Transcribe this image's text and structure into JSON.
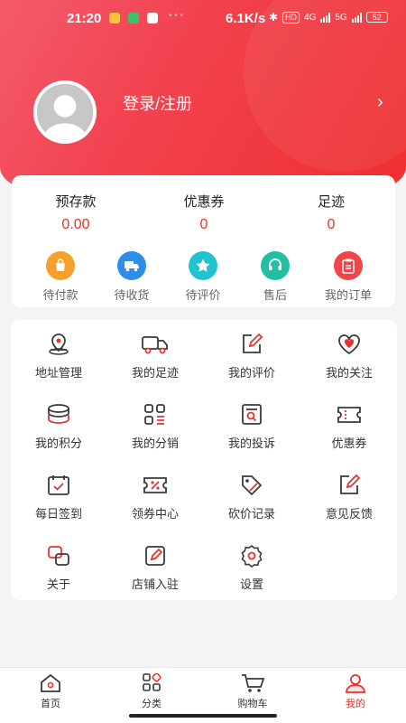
{
  "status_bar": {
    "time": "21:20",
    "dots": "···",
    "speed": "6.1K/s",
    "hd": "HD",
    "net1": "4G",
    "net2": "5G",
    "battery": "52"
  },
  "profile": {
    "login_label": "登录/注册",
    "arrow": "›"
  },
  "stats": [
    {
      "label": "预存款",
      "value": "0.00"
    },
    {
      "label": "优惠券",
      "value": "0"
    },
    {
      "label": "足迹",
      "value": "0"
    }
  ],
  "orders": [
    {
      "label": "待付款",
      "color": "#f6a02c",
      "icon": "bag-icon"
    },
    {
      "label": "待收货",
      "color": "#2d8ee8",
      "icon": "truck-icon"
    },
    {
      "label": "待评价",
      "color": "#22c2d0",
      "icon": "star-icon"
    },
    {
      "label": "售后",
      "color": "#23bfa3",
      "icon": "headset-icon"
    },
    {
      "label": "我的订单",
      "color": "#f0464a",
      "icon": "clipboard-icon"
    }
  ],
  "services": [
    {
      "label": "地址管理",
      "icon": "location-pin-icon"
    },
    {
      "label": "我的足迹",
      "icon": "truck-outline-icon"
    },
    {
      "label": "我的评价",
      "icon": "edit-square-icon"
    },
    {
      "label": "我的关注",
      "icon": "heart-icon"
    },
    {
      "label": "我的积分",
      "icon": "coin-stack-icon"
    },
    {
      "label": "我的分销",
      "icon": "grid-apps-icon"
    },
    {
      "label": "我的投诉",
      "icon": "complaint-icon"
    },
    {
      "label": "优惠券",
      "icon": "ticket-icon"
    },
    {
      "label": "每日签到",
      "icon": "calendar-check-icon"
    },
    {
      "label": "领券中心",
      "icon": "percent-coupon-icon"
    },
    {
      "label": "砍价记录",
      "icon": "price-tag-icon"
    },
    {
      "label": "意见反馈",
      "icon": "feedback-pen-icon"
    },
    {
      "label": "关于",
      "icon": "about-icon"
    },
    {
      "label": "店铺入驻",
      "icon": "store-join-icon"
    },
    {
      "label": "设置",
      "icon": "gear-icon"
    }
  ],
  "tabs": [
    {
      "label": "首页",
      "icon": "home-icon",
      "active": false
    },
    {
      "label": "分类",
      "icon": "category-icon",
      "active": false
    },
    {
      "label": "购物车",
      "icon": "cart-icon",
      "active": false
    },
    {
      "label": "我的",
      "icon": "user-icon",
      "active": true
    }
  ],
  "colors": {
    "primary": "#e9322e",
    "icon_dark": "#3a3a3a",
    "icon_accent": "#e9322e"
  }
}
